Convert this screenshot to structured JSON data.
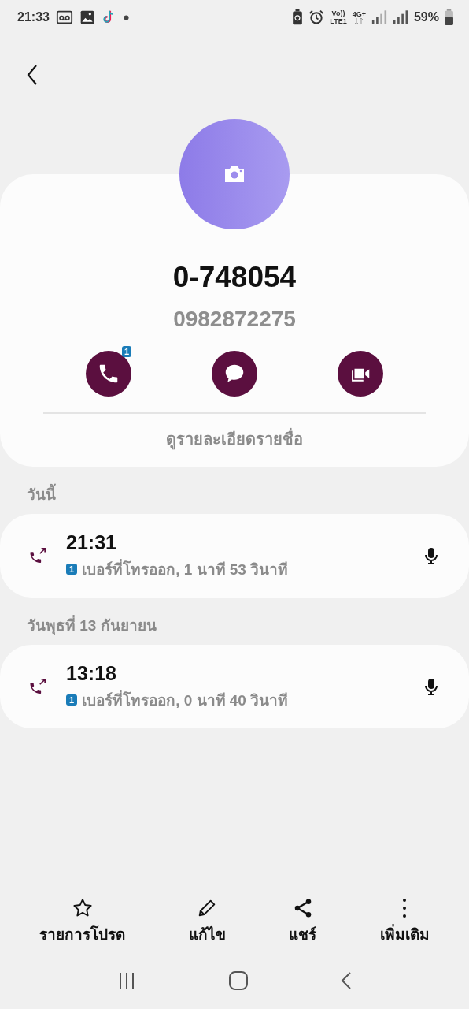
{
  "status_bar": {
    "time": "21:33",
    "volte": "Vo))",
    "lte": "LTE1",
    "network": "4G+",
    "battery": "59%"
  },
  "contact": {
    "name": "0-748054",
    "number": "0982872275",
    "details_link": "ดูรายละเอียดรายชื่อ",
    "actions": [
      {
        "kind": "call",
        "badge": "1"
      },
      {
        "kind": "message"
      },
      {
        "kind": "video"
      }
    ]
  },
  "history": [
    {
      "date": "วันนี้",
      "calls": [
        {
          "time": "21:31",
          "sim": "1",
          "description": "เบอร์ที่โทรออก, 1 นาที 53 วินาที"
        }
      ]
    },
    {
      "date": "วันพุธที่ 13 กันยายน",
      "calls": [
        {
          "time": "13:18",
          "sim": "1",
          "description": "เบอร์ที่โทรออก, 0 นาที 40 วินาที"
        }
      ]
    }
  ],
  "bottom_actions": [
    {
      "kind": "favorite",
      "label": "รายการโปรด"
    },
    {
      "kind": "edit",
      "label": "แก้ไข"
    },
    {
      "kind": "share",
      "label": "แชร์"
    },
    {
      "kind": "more",
      "label": "เพิ่มเติม"
    }
  ]
}
